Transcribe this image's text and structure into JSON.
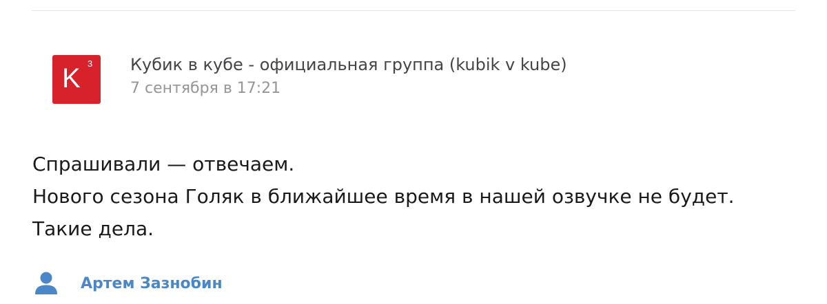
{
  "post": {
    "group_avatar": {
      "letter": "K",
      "superscript": "3",
      "color": "#d8222b"
    },
    "group_name": "Кубик в кубе - официальная группа (kubik v kube)",
    "date": "7 сентября в 17:21",
    "text_lines": [
      "Спрашивали — отвечаем.",
      "Нового сезона Голяк в ближайшее время в нашей озвучке не будет.",
      "Такие дела."
    ],
    "author": {
      "icon": "user-icon",
      "name": "Артем Зазнобин",
      "color": "#4a87c8"
    }
  }
}
